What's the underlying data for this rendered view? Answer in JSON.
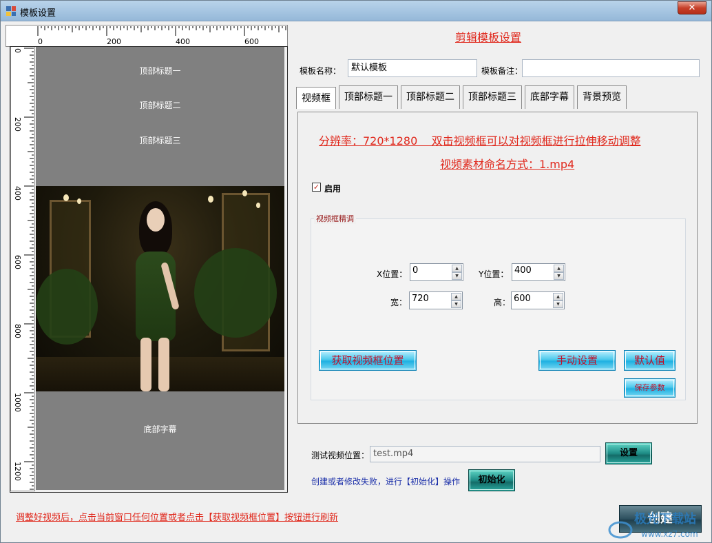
{
  "window": {
    "title": "模板设置",
    "close_glyph": "✕"
  },
  "ruler": {
    "h_labels": [
      "0",
      "200",
      "400",
      "600"
    ],
    "v_labels": [
      "0",
      "200",
      "400",
      "600",
      "800",
      "1000",
      "1200"
    ]
  },
  "preview": {
    "top_title_1": "顶部标题一",
    "top_title_2": "顶部标题二",
    "top_title_3": "顶部标题三",
    "bottom_caption": "底部字幕"
  },
  "heading": "剪辑模板设置",
  "template": {
    "name_label": "模板名称：",
    "name_value": "默认模板",
    "note_label": "模板备注：",
    "note_value": ""
  },
  "tabs": [
    "视频框",
    "顶部标题一",
    "顶部标题二",
    "顶部标题三",
    "底部字幕",
    "背景预览"
  ],
  "panel": {
    "info_line_1": "分辨率：720*1280    双击视频框可以对视频框进行拉伸移动调整",
    "info_line_2": "视频素材命名方式：1.mp4",
    "enable_label": "启用",
    "enable_checked": true,
    "group_title": "视频框精调",
    "x_label": "X位置：",
    "x_value": "0",
    "y_label": "Y位置：",
    "y_value": "400",
    "w_label": "宽：",
    "w_value": "720",
    "h_label": "高：",
    "h_value": "600",
    "get_pos_button": "获取视频框位置",
    "manual_button": "手动设置",
    "default_button": "默认值",
    "save_button": "保存参数"
  },
  "test": {
    "label": "测试视频位置：",
    "value": "test.mp4",
    "set_button": "设置",
    "init_hint": "创建或者修改失败，进行【初始化】操作",
    "init_button": "初始化"
  },
  "footer_hint": "调整好视频后，点击当前窗口任何位置或者点击【获取视频框位置】按钮进行刷新",
  "create_button": "创建",
  "watermark": {
    "text": "极光下载站",
    "url": "www.xz7.com"
  },
  "colors": {
    "accent_red": "#e0281c",
    "cyan_button": "#1fb1e1",
    "teal_button": "#1e8c86"
  }
}
